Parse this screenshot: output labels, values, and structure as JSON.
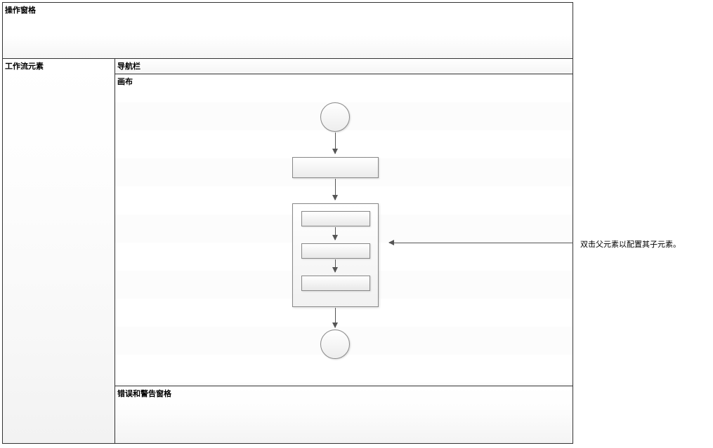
{
  "panes": {
    "actions": {
      "label": "操作窗格"
    },
    "elements": {
      "label": "工作流元素"
    },
    "nav": {
      "label": "导航栏"
    },
    "canvas": {
      "label": "画布"
    },
    "errors": {
      "label": "错误和警告窗格"
    }
  },
  "callout": {
    "text": "双击父元素以配置其子元素。"
  },
  "flowchart": {
    "nodes": [
      {
        "id": "start",
        "type": "circle"
      },
      {
        "id": "step1",
        "type": "rect"
      },
      {
        "id": "group",
        "type": "group",
        "children": [
          {
            "id": "child1",
            "type": "rect"
          },
          {
            "id": "child2",
            "type": "rect"
          },
          {
            "id": "child3",
            "type": "rect"
          }
        ]
      },
      {
        "id": "end",
        "type": "circle"
      }
    ],
    "edges": [
      {
        "from": "start",
        "to": "step1"
      },
      {
        "from": "step1",
        "to": "group"
      },
      {
        "from": "group",
        "to": "end"
      },
      {
        "from": "child1",
        "to": "child2"
      },
      {
        "from": "child2",
        "to": "child3"
      }
    ]
  }
}
